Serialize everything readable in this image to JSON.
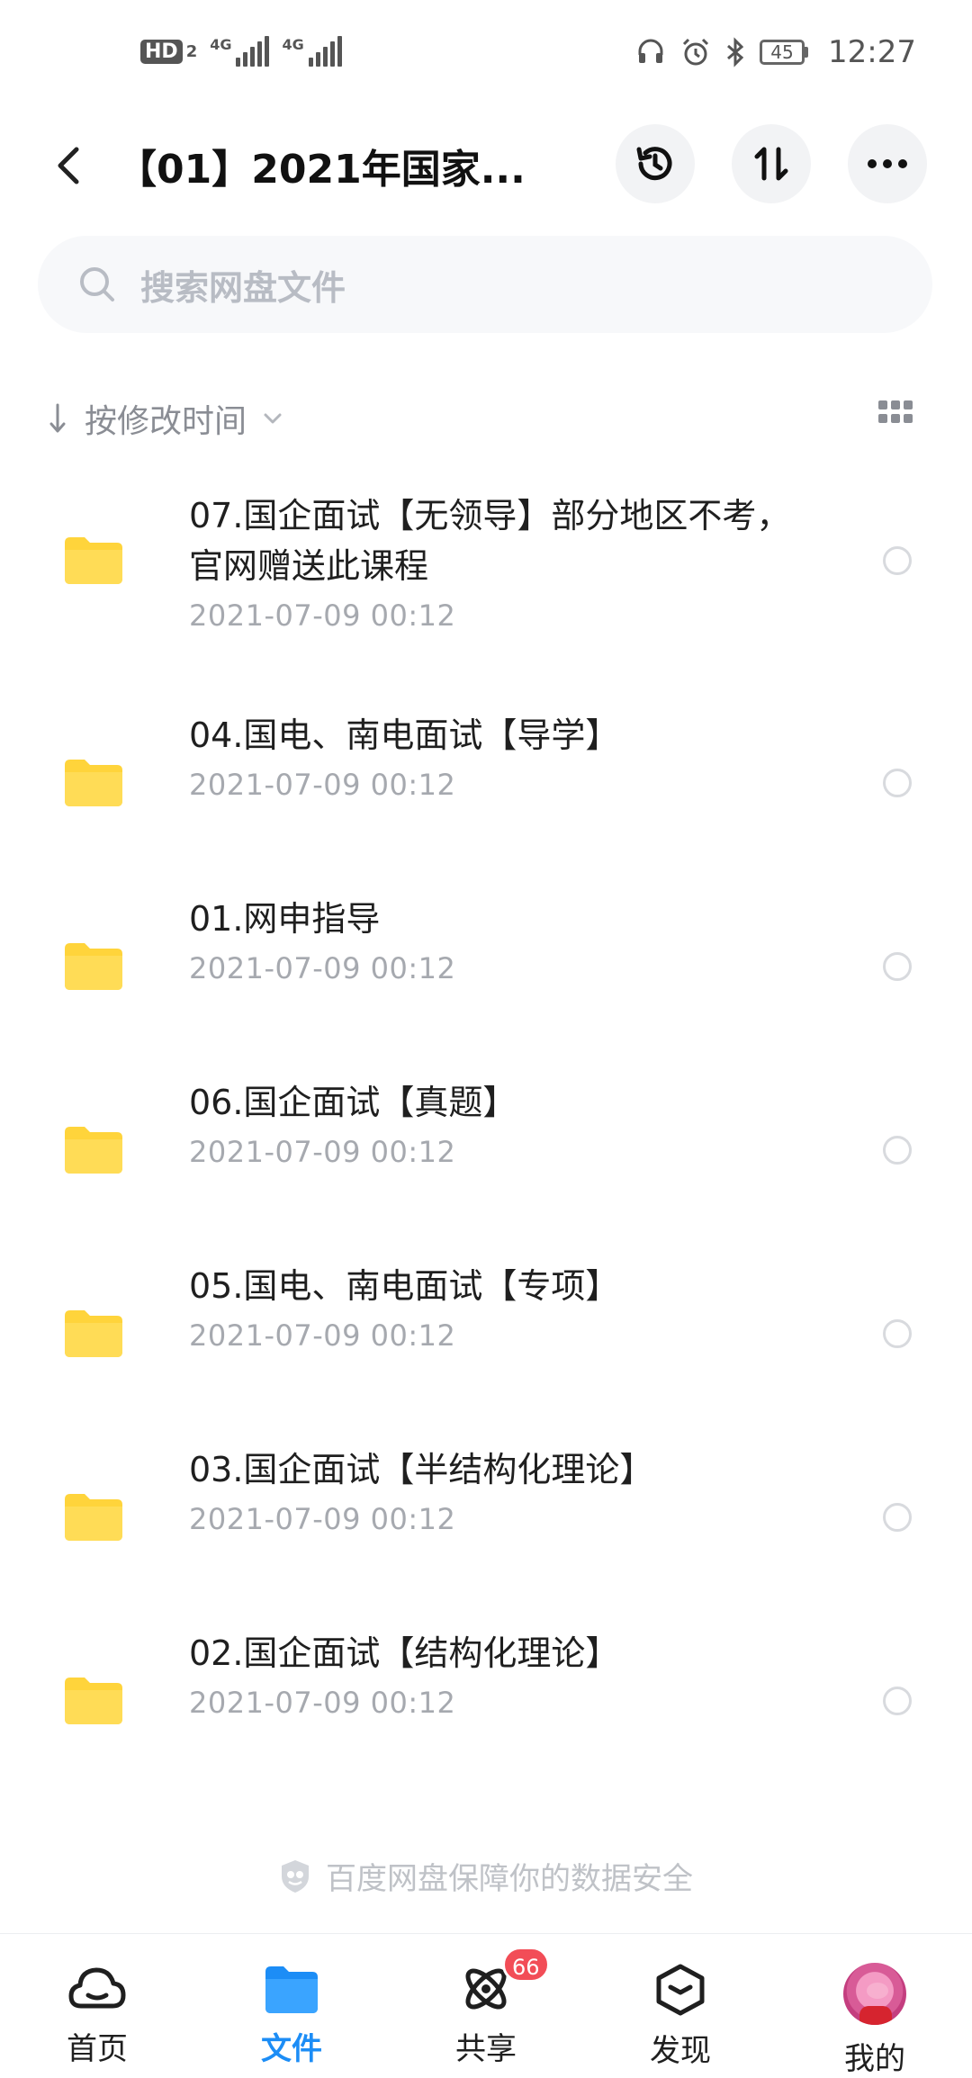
{
  "status_bar": {
    "hd_label": "HD",
    "hd_sub": "2",
    "signal1_label": "4G",
    "signal2_label": "4G",
    "battery": "45",
    "time": "12:27"
  },
  "header": {
    "title": "【01】2021年国家..."
  },
  "search": {
    "placeholder": "搜索网盘文件"
  },
  "sort": {
    "label": "按修改时间"
  },
  "files": [
    {
      "name": "07.国企面试【无领导】部分地区不考，官网赠送此课程",
      "date": "2021-07-09  00:12"
    },
    {
      "name": "04.国电、南电面试【导学】",
      "date": "2021-07-09  00:12"
    },
    {
      "name": "01.网申指导",
      "date": "2021-07-09  00:12"
    },
    {
      "name": "06.国企面试【真题】",
      "date": "2021-07-09  00:12"
    },
    {
      "name": "05.国电、南电面试【专项】",
      "date": "2021-07-09  00:12"
    },
    {
      "name": "03.国企面试【半结构化理论】",
      "date": "2021-07-09  00:12"
    },
    {
      "name": "02.国企面试【结构化理论】",
      "date": "2021-07-09  00:12"
    }
  ],
  "footer": {
    "safety_text": "百度网盘保障你的数据安全"
  },
  "tabs": [
    {
      "label": "首页",
      "icon": "cloud-home-icon"
    },
    {
      "label": "文件",
      "icon": "folder-icon",
      "active": true
    },
    {
      "label": "共享",
      "icon": "share-orbit-icon",
      "badge": "66"
    },
    {
      "label": "发现",
      "icon": "discover-cube-icon"
    },
    {
      "label": "我的",
      "icon": "avatar"
    }
  ],
  "colors": {
    "accent": "#1c8df6",
    "folder": "#ffd43b",
    "badge": "#f24d57"
  }
}
